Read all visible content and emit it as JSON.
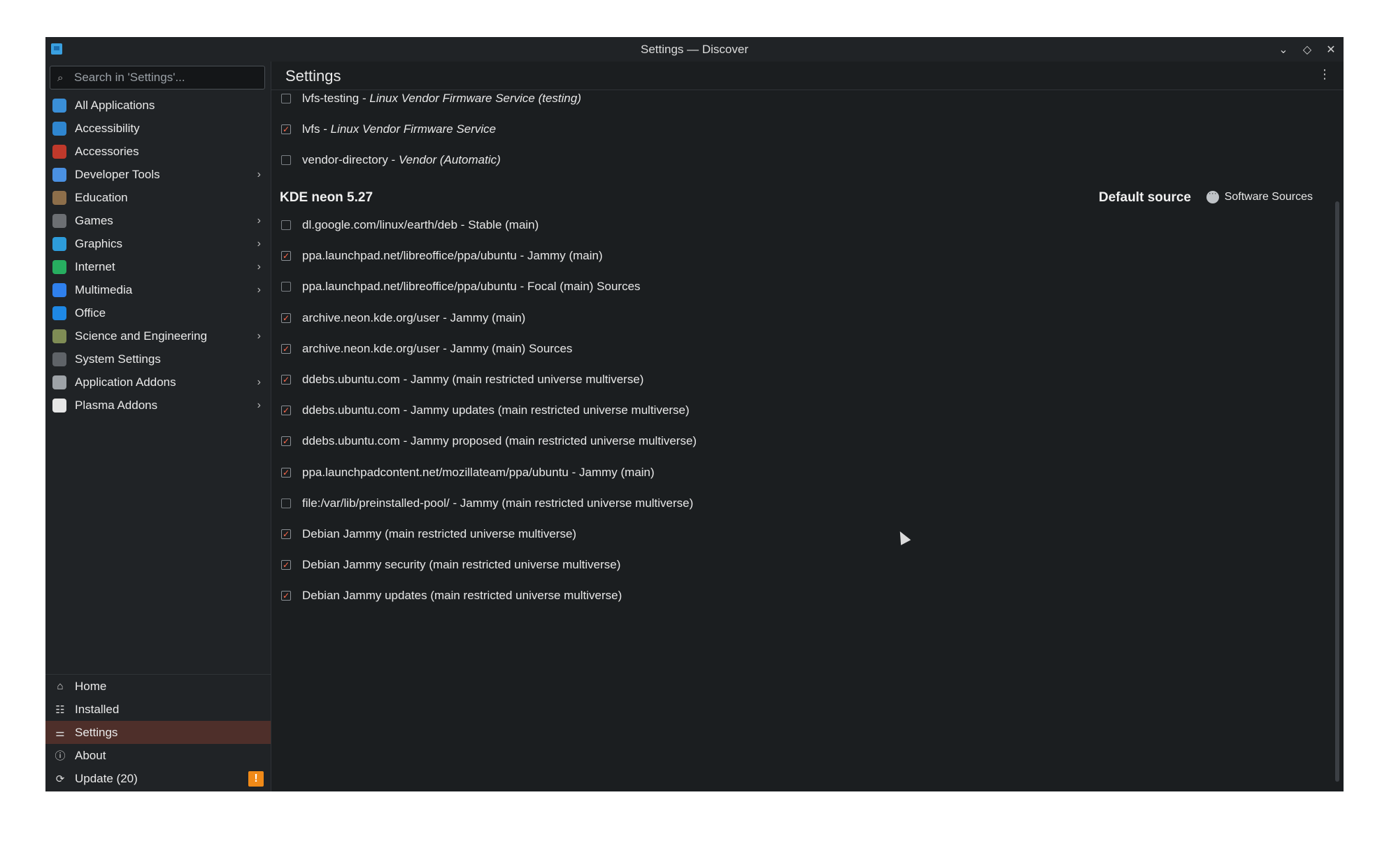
{
  "window": {
    "title": "Settings — Discover"
  },
  "search": {
    "placeholder": "Search in 'Settings'..."
  },
  "categories": [
    {
      "label": "All Applications",
      "has_children": false,
      "icon_color": "#3a8fd8"
    },
    {
      "label": "Accessibility",
      "has_children": false,
      "icon_color": "#2f86d0"
    },
    {
      "label": "Accessories",
      "has_children": false,
      "icon_color": "#c0392b"
    },
    {
      "label": "Developer Tools",
      "has_children": true,
      "icon_color": "#4a90e2"
    },
    {
      "label": "Education",
      "has_children": false,
      "icon_color": "#8d6e4a"
    },
    {
      "label": "Games",
      "has_children": true,
      "icon_color": "#6c6f73"
    },
    {
      "label": "Graphics",
      "has_children": true,
      "icon_color": "#2d9cdb"
    },
    {
      "label": "Internet",
      "has_children": true,
      "icon_color": "#27ae60"
    },
    {
      "label": "Multimedia",
      "has_children": true,
      "icon_color": "#2f80ed"
    },
    {
      "label": "Office",
      "has_children": false,
      "icon_color": "#1e88e5"
    },
    {
      "label": "Science and Engineering",
      "has_children": true,
      "icon_color": "#7f8c55"
    },
    {
      "label": "System Settings",
      "has_children": false,
      "icon_color": "#5f6368"
    },
    {
      "label": "Application Addons",
      "has_children": true,
      "icon_color": "#9ea3a8"
    },
    {
      "label": "Plasma Addons",
      "has_children": true,
      "icon_color": "#e6e6e6"
    }
  ],
  "nav": [
    {
      "label": "Home",
      "icon": "home-icon",
      "glyph": "⌂"
    },
    {
      "label": "Installed",
      "icon": "installed-icon",
      "glyph": "☷"
    },
    {
      "label": "Settings",
      "icon": "settings-icon",
      "glyph": "⚌",
      "active": true
    },
    {
      "label": "About",
      "icon": "about-icon",
      "glyph": "ⓘ"
    },
    {
      "label": "Update (20)",
      "icon": "update-icon",
      "glyph": "⟳",
      "badge": "!"
    }
  ],
  "page": {
    "title": "Settings"
  },
  "firmware_sources": [
    {
      "name": "lvfs-testing - ",
      "desc": "Linux Vendor Firmware Service (testing)",
      "checked": false
    },
    {
      "name": "lvfs - ",
      "desc": "Linux Vendor Firmware Service",
      "checked": true
    },
    {
      "name": "vendor-directory - ",
      "desc": "Vendor (Automatic)",
      "checked": false
    }
  ],
  "section": {
    "title": "KDE neon 5.27",
    "default_label": "Default source",
    "button_label": "Software Sources"
  },
  "sources": [
    {
      "label": "dl.google.com/linux/earth/deb - Stable (main)",
      "checked": false
    },
    {
      "label": "ppa.launchpad.net/libreoffice/ppa/ubuntu - Jammy (main)",
      "checked": true
    },
    {
      "label": "ppa.launchpad.net/libreoffice/ppa/ubuntu - Focal (main) Sources",
      "checked": false
    },
    {
      "label": "archive.neon.kde.org/user - Jammy (main)",
      "checked": true
    },
    {
      "label": "archive.neon.kde.org/user - Jammy (main) Sources",
      "checked": true
    },
    {
      "label": "ddebs.ubuntu.com - Jammy (main restricted universe multiverse)",
      "checked": true
    },
    {
      "label": "ddebs.ubuntu.com - Jammy updates (main restricted universe multiverse)",
      "checked": true
    },
    {
      "label": "ddebs.ubuntu.com - Jammy proposed (main restricted universe multiverse)",
      "checked": true
    },
    {
      "label": "ppa.launchpadcontent.net/mozillateam/ppa/ubuntu - Jammy (main)",
      "checked": true
    },
    {
      "label": "file:/var/lib/preinstalled-pool/ - Jammy (main restricted universe multiverse)",
      "checked": false
    },
    {
      "label": "Debian Jammy (main restricted universe multiverse)",
      "checked": true
    },
    {
      "label": "Debian Jammy security (main restricted universe multiverse)",
      "checked": true
    },
    {
      "label": "Debian Jammy updates (main restricted universe multiverse)",
      "checked": true
    }
  ]
}
